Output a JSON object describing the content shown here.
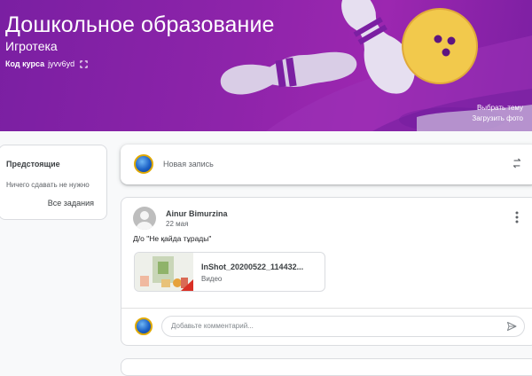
{
  "banner": {
    "title": "Дошкольное образование",
    "section": "Игротека",
    "code_label": "Код курса",
    "code_value": "jyvv6yd",
    "select_theme": "Выбрать тему",
    "upload_photo": "Загрузить фото",
    "color": "#8e24aa"
  },
  "upcoming": {
    "title": "Предстоящие",
    "empty_text": "Ничего сдавать не нужно",
    "all_link": "Все задания"
  },
  "new_post": {
    "label": "Новая запись",
    "repost_icon": "repost-icon"
  },
  "post": {
    "author": "Ainur Bimurzina",
    "date": "22 мая",
    "text": "Д/о \"Не қайда тұрады\"",
    "attachment": {
      "name": "InShot_20200522_114432...",
      "type": "Видео"
    },
    "comment_placeholder": "Добавьте комментарий..."
  }
}
